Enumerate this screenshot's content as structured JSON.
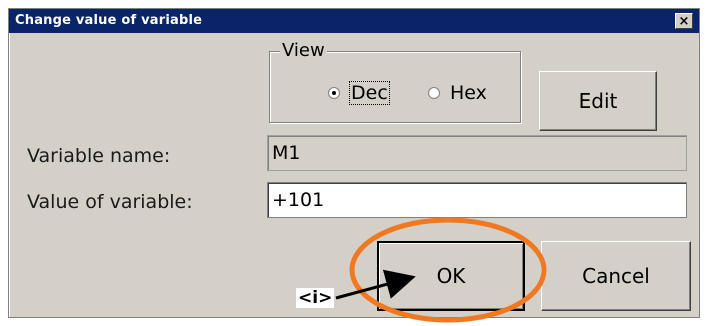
{
  "window": {
    "title": "Change value of variable",
    "close_glyph": "×"
  },
  "view_group": {
    "legend": "View",
    "options": [
      {
        "label": "Dec",
        "selected": true
      },
      {
        "label": "Hex",
        "selected": false
      }
    ]
  },
  "buttons": {
    "edit": "Edit",
    "ok": "OK",
    "cancel": "Cancel"
  },
  "form": {
    "variable_name_label": "Variable name:",
    "variable_name_value": "M1",
    "variable_value_label": "Value of variable:",
    "variable_value_value": "+101"
  },
  "annotation": {
    "marker_text": "<i>",
    "highlight_color": "#f07820",
    "arrow_color": "#000000"
  },
  "colors": {
    "titlebar": "#0a246a",
    "dialog_face": "#d4d0c8"
  }
}
